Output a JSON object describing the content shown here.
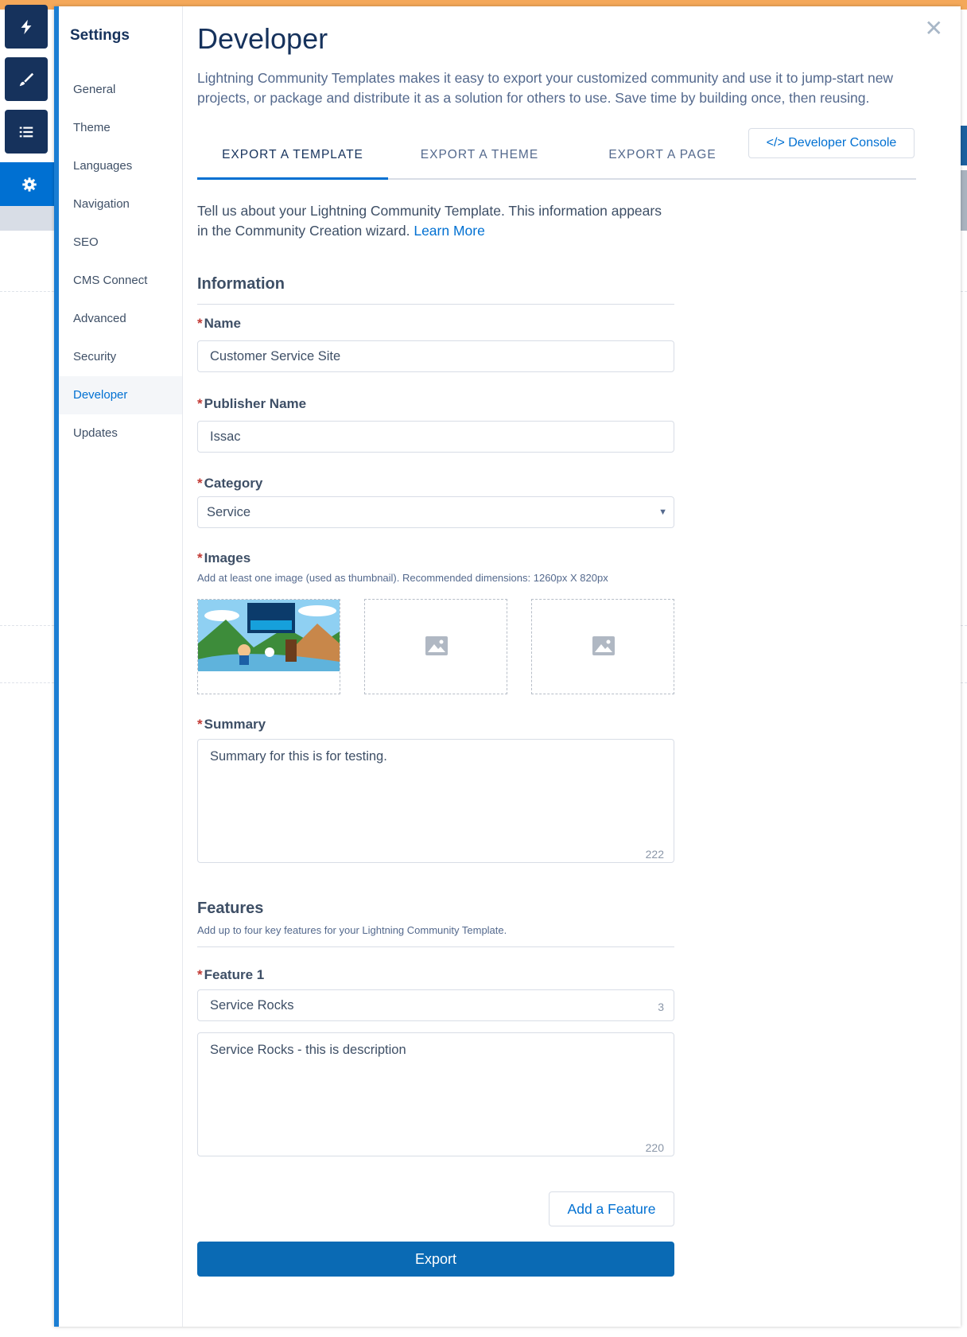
{
  "rail": {
    "items": [
      {
        "icon": "lightning-icon"
      },
      {
        "icon": "brush-icon"
      },
      {
        "icon": "list-icon"
      },
      {
        "icon": "gear-icon"
      }
    ]
  },
  "settings_nav": {
    "title": "Settings",
    "items": [
      {
        "label": "General"
      },
      {
        "label": "Theme"
      },
      {
        "label": "Languages"
      },
      {
        "label": "Navigation"
      },
      {
        "label": "SEO"
      },
      {
        "label": "CMS Connect"
      },
      {
        "label": "Advanced"
      },
      {
        "label": "Security"
      },
      {
        "label": "Developer",
        "active": true
      },
      {
        "label": "Updates"
      }
    ]
  },
  "page": {
    "title": "Developer",
    "intro": "Lightning Community Templates makes it easy to export your customized community and use it to jump-start new projects, or package and distribute it as a solution for others to use. Save time by building once, then reusing."
  },
  "tabs": [
    {
      "label": "EXPORT A TEMPLATE",
      "active": true
    },
    {
      "label": "EXPORT A THEME"
    },
    {
      "label": "EXPORT A PAGE"
    }
  ],
  "developer_console_label": "</> Developer Console",
  "form": {
    "description": "Tell us about your Lightning Community Template. This information appears in the Community Creation wizard.",
    "learn_more": "Learn More",
    "information_heading": "Information",
    "required_mark": "*",
    "name_label": "Name",
    "name_value": "Customer Service Site",
    "publisher_label": "Publisher Name",
    "publisher_value": "Issac",
    "category_label": "Category",
    "category_value": "Service",
    "images_label": "Images",
    "images_hint": "Add at least one image (used as thumbnail). Recommended dimensions: 1260px X 820px",
    "summary_label": "Summary",
    "summary_value": "Summary for this is for testing.",
    "summary_count": "222",
    "features_heading": "Features",
    "features_hint": "Add up to four key features for your Lightning Community Template.",
    "feature1_label": "Feature 1",
    "feature1_title": "Service Rocks",
    "feature1_title_count": "3",
    "feature1_description": "Service Rocks - this is description",
    "feature1_description_count": "220",
    "add_feature_label": "Add a Feature",
    "export_label": "Export"
  },
  "colors": {
    "brand": "#0070d2",
    "export_button": "#0a6ab4",
    "rail": "#16325c",
    "required": "#c23934"
  }
}
